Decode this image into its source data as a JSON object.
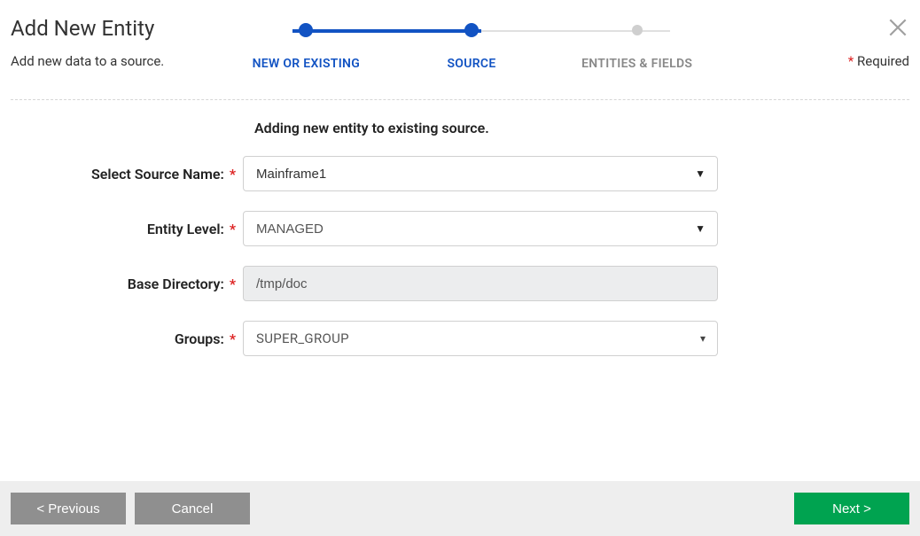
{
  "header": {
    "title": "Add New Entity",
    "subtitle": "Add new data to a source.",
    "required_label": "Required"
  },
  "steps": [
    {
      "label": "NEW OR EXISTING",
      "state": "done"
    },
    {
      "label": "SOURCE",
      "state": "active"
    },
    {
      "label": "ENTITIES & FIELDS",
      "state": "inactive"
    }
  ],
  "form": {
    "heading": "Adding new entity to existing source.",
    "source_name": {
      "label": "Select Source Name:",
      "value": "Mainframe1",
      "required": true
    },
    "entity_level": {
      "label": "Entity Level:",
      "value": "MANAGED",
      "required": true
    },
    "base_directory": {
      "label": "Base Directory:",
      "value": "/tmp/doc",
      "required": true
    },
    "groups": {
      "label": "Groups:",
      "value": "SUPER_GROUP",
      "required": true
    }
  },
  "footer": {
    "previous": "< Previous",
    "cancel": "Cancel",
    "next": "Next >"
  }
}
